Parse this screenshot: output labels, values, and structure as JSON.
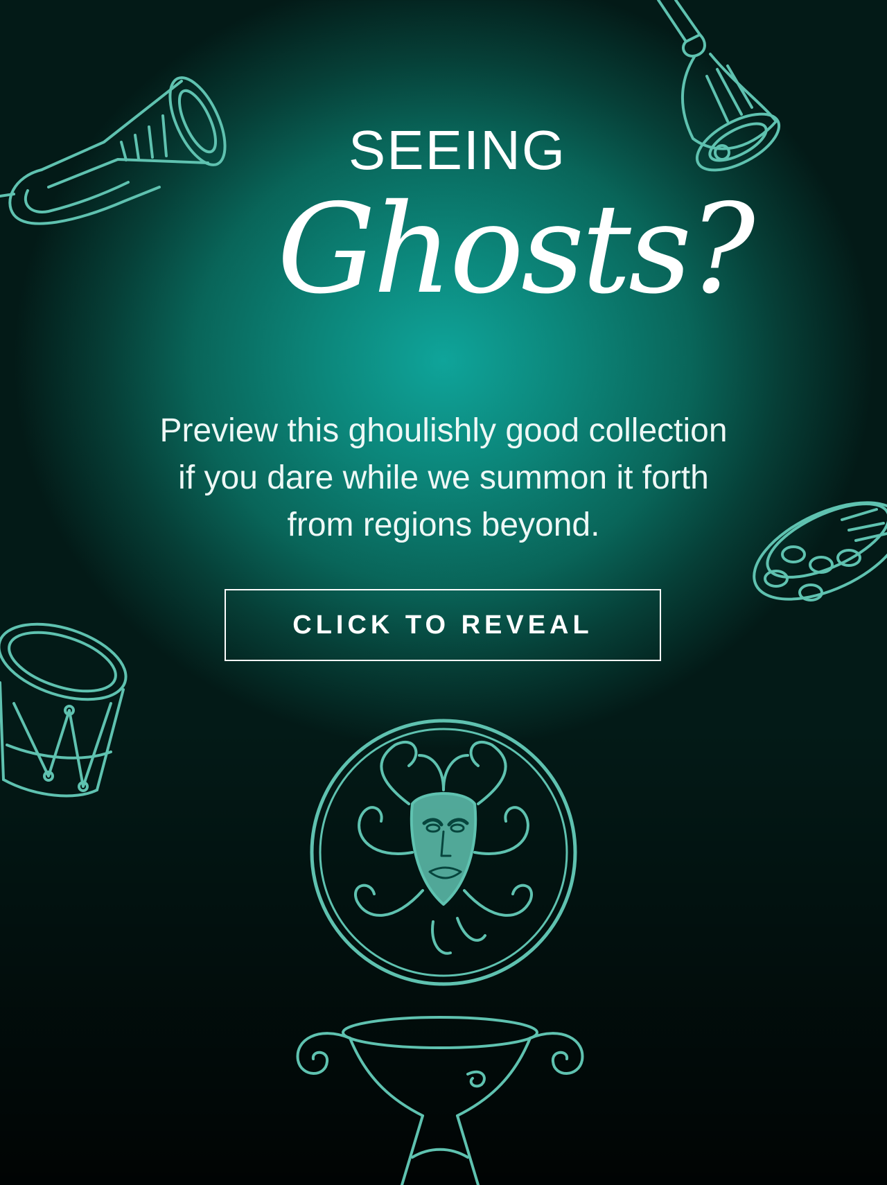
{
  "hero": {
    "eyebrow": "SEEING",
    "headline": "Ghosts?",
    "intro_lines": [
      "Preview this ghoulishly good collection",
      "if you dare while we summon it forth",
      "from regions beyond."
    ],
    "cta_label": "CLICK TO REVEAL"
  },
  "colors": {
    "background_center": "#0fa49a",
    "background_edge": "#031a17",
    "line_art": "#5fc2b0",
    "text": "#ffffff"
  },
  "decorations": [
    "horn-icon",
    "bell-icon",
    "tambourine-icon",
    "drum-icon",
    "crystal-ball-medallion",
    "pedestal-stand"
  ]
}
